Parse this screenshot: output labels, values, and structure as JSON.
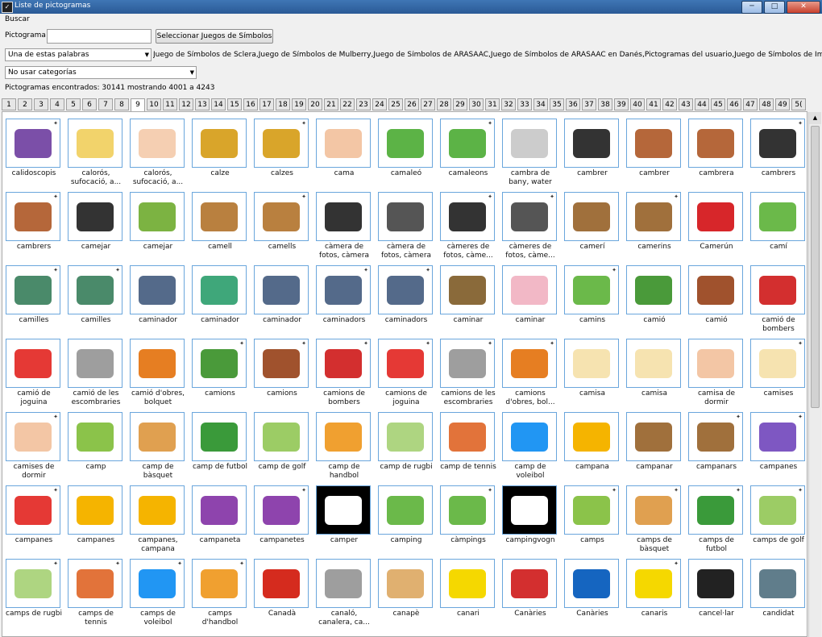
{
  "window": {
    "title": "Liste de pictogramas",
    "minimize": "─",
    "maximize": "□",
    "close": "✕"
  },
  "menu": {
    "search": "Buscar"
  },
  "search": {
    "label": "Pictograma",
    "value": "",
    "select_sets_button": "Seleccionar Juegos de Símbolos"
  },
  "word_mode": {
    "selected": "Una de estas palabras"
  },
  "sets_text": "Juego de Símbolos de Sclera,Juego de Símbolos de Mulberry,Juego de Símbolos de ARASAAC,Juego de Símbolos de ARASAAC en Danés,Pictogramas del usuario,Juego de Símbolos de Imagi",
  "category": {
    "selected": "No usar categorías"
  },
  "results_text": "Pictogramas encontrados: 30141 mostrando 4001 a 4243",
  "pages": {
    "active": "9",
    "items": [
      "1",
      "2",
      "3",
      "4",
      "5",
      "6",
      "7",
      "8",
      "9",
      "10",
      "11",
      "12",
      "13",
      "14",
      "15",
      "16",
      "17",
      "18",
      "19",
      "20",
      "21",
      "22",
      "23",
      "24",
      "25",
      "26",
      "27",
      "28",
      "29",
      "30",
      "31",
      "32",
      "33",
      "34",
      "35",
      "36",
      "37",
      "38",
      "39",
      "40",
      "41",
      "42",
      "43",
      "44",
      "45",
      "46",
      "47",
      "48",
      "49",
      "5("
    ]
  },
  "colors": {
    "cell_border": "#6aa6dc",
    "tab_active": "#ffffff",
    "titlebar": "#3f76b5"
  },
  "pictograms": [
    {
      "label": "calidoscopis",
      "star": true,
      "icon": "kaleidoscope-icon",
      "color": "#7b4fa8"
    },
    {
      "label": "calorós, sufocació, a...",
      "star": false,
      "icon": "hot-face-icon",
      "color": "#f2d36b"
    },
    {
      "label": "calorós, sufocació, a...",
      "star": false,
      "icon": "hot-baby-icon",
      "color": "#f5cfb2"
    },
    {
      "label": "calze",
      "star": false,
      "icon": "chalice-icon",
      "color": "#d9a52a"
    },
    {
      "label": "calzes",
      "star": true,
      "icon": "chalices-icon",
      "color": "#d9a52a"
    },
    {
      "label": "cama",
      "star": false,
      "icon": "leg-icon",
      "color": "#f3c6a5"
    },
    {
      "label": "camaleó",
      "star": false,
      "icon": "chameleon-icon",
      "color": "#5cb346"
    },
    {
      "label": "camaleons",
      "star": true,
      "icon": "chameleons-icon",
      "color": "#5cb346"
    },
    {
      "label": "cambra de bany, water",
      "star": false,
      "icon": "toilet-icon",
      "color": "#cccccc"
    },
    {
      "label": "cambrer",
      "star": false,
      "icon": "waiter-icon",
      "color": "#333333"
    },
    {
      "label": "cambrer",
      "star": false,
      "icon": "bar-waiter-icon",
      "color": "#b5673a"
    },
    {
      "label": "cambrera",
      "star": false,
      "icon": "bar-waitress-icon",
      "color": "#b5673a"
    },
    {
      "label": "cambrers",
      "star": true,
      "icon": "waiters-icon",
      "color": "#333333"
    },
    {
      "label": "cambrers",
      "star": true,
      "icon": "bar-waiters-icon",
      "color": "#b5673a"
    },
    {
      "label": "camejar",
      "star": false,
      "icon": "kicking-icon",
      "color": "#333333"
    },
    {
      "label": "camejar",
      "star": false,
      "icon": "kicking-child-icon",
      "color": "#7cb342"
    },
    {
      "label": "camell",
      "star": false,
      "icon": "camel-icon",
      "color": "#b9803f"
    },
    {
      "label": "camells",
      "star": true,
      "icon": "camels-icon",
      "color": "#b9803f"
    },
    {
      "label": "càmera de fotos, càmera",
      "star": false,
      "icon": "camera-icon",
      "color": "#333333"
    },
    {
      "label": "càmera de fotos, càmera",
      "star": false,
      "icon": "camera-photo-icon",
      "color": "#555555"
    },
    {
      "label": "càmeres de fotos, càme...",
      "star": true,
      "icon": "cameras-icon",
      "color": "#333333"
    },
    {
      "label": "càmeres de fotos, càme...",
      "star": true,
      "icon": "cameras-photo-icon",
      "color": "#555555"
    },
    {
      "label": "camerí",
      "star": false,
      "icon": "dressing-table-icon",
      "color": "#a0703c"
    },
    {
      "label": "camerins",
      "star": true,
      "icon": "dressing-tables-icon",
      "color": "#a0703c"
    },
    {
      "label": "Camerún",
      "star": false,
      "icon": "cameroon-flag-icon",
      "color": "#d7262a"
    },
    {
      "label": "camí",
      "star": false,
      "icon": "path-icon",
      "color": "#6bb94a"
    },
    {
      "label": "camilles",
      "star": true,
      "icon": "stretcher-icon",
      "color": "#4a8a6a"
    },
    {
      "label": "camilles",
      "star": true,
      "icon": "stretchers-icon",
      "color": "#4a8a6a"
    },
    {
      "label": "caminador",
      "star": false,
      "icon": "walker-icon",
      "color": "#546a8a"
    },
    {
      "label": "caminador",
      "star": false,
      "icon": "baby-walker-icon",
      "color": "#3fa77a"
    },
    {
      "label": "caminador",
      "star": false,
      "icon": "rollator-icon",
      "color": "#546a8a"
    },
    {
      "label": "caminadors",
      "star": true,
      "icon": "walkers-icon",
      "color": "#546a8a"
    },
    {
      "label": "caminadors",
      "star": true,
      "icon": "rollators-icon",
      "color": "#546a8a"
    },
    {
      "label": "caminar",
      "star": false,
      "icon": "walking-icon",
      "color": "#8a6a3a"
    },
    {
      "label": "caminar",
      "star": false,
      "icon": "baby-walking-icon",
      "color": "#f2b8c6"
    },
    {
      "label": "camins",
      "star": true,
      "icon": "paths-icon",
      "color": "#6bb94a"
    },
    {
      "label": "camió",
      "star": false,
      "icon": "truck-icon",
      "color": "#4a9a3a"
    },
    {
      "label": "camió",
      "star": false,
      "icon": "truck-2-icon",
      "color": "#a0522d"
    },
    {
      "label": "camió de bombers",
      "star": false,
      "icon": "fire-truck-icon",
      "color": "#d32f2f"
    },
    {
      "label": "camió de joguina",
      "star": false,
      "icon": "toy-truck-icon",
      "color": "#e53935"
    },
    {
      "label": "camió de les escombraries",
      "star": false,
      "icon": "garbage-truck-icon",
      "color": "#9e9e9e"
    },
    {
      "label": "camió d'obres, bolquet",
      "star": false,
      "icon": "dump-truck-icon",
      "color": "#e67e22"
    },
    {
      "label": "camions",
      "star": true,
      "icon": "trucks-icon",
      "color": "#4a9a3a"
    },
    {
      "label": "camions",
      "star": true,
      "icon": "trucks-2-icon",
      "color": "#a0522d"
    },
    {
      "label": "camions de bombers",
      "star": true,
      "icon": "fire-trucks-icon",
      "color": "#d32f2f"
    },
    {
      "label": "camions de joguina",
      "star": true,
      "icon": "toy-trucks-icon",
      "color": "#e53935"
    },
    {
      "label": "camions de les escombraries",
      "star": true,
      "icon": "garbage-trucks-icon",
      "color": "#9e9e9e"
    },
    {
      "label": "camions d'obres, bol...",
      "star": true,
      "icon": "dump-trucks-icon",
      "color": "#e67e22"
    },
    {
      "label": "camisa",
      "star": false,
      "icon": "shirt-icon",
      "color": "#f6e3b0"
    },
    {
      "label": "camisa",
      "star": false,
      "icon": "shirt-2-icon",
      "color": "#f6e3b0"
    },
    {
      "label": "camisa de dormir",
      "star": false,
      "icon": "nightgown-icon",
      "color": "#f3c6a5"
    },
    {
      "label": "camises",
      "star": true,
      "icon": "shirts-icon",
      "color": "#f6e3b0"
    },
    {
      "label": "camises de dormir",
      "star": true,
      "icon": "nightgowns-icon",
      "color": "#f3c6a5"
    },
    {
      "label": "camp",
      "star": false,
      "icon": "field-icon",
      "color": "#8bc34a"
    },
    {
      "label": "camp de bàsquet",
      "star": false,
      "icon": "basketball-court-icon",
      "color": "#e0a050"
    },
    {
      "label": "camp de futbol",
      "star": false,
      "icon": "football-field-icon",
      "color": "#3a9a3a"
    },
    {
      "label": "camp de golf",
      "star": false,
      "icon": "golf-course-icon",
      "color": "#9ccc65"
    },
    {
      "label": "camp de handbol",
      "star": false,
      "icon": "handball-court-icon",
      "color": "#f0a030"
    },
    {
      "label": "camp de rugbi",
      "star": false,
      "icon": "rugby-field-icon",
      "color": "#aed581"
    },
    {
      "label": "camp de tennis",
      "star": false,
      "icon": "tennis-court-icon",
      "color": "#e2733a"
    },
    {
      "label": "camp de voleibol",
      "star": false,
      "icon": "volleyball-court-icon",
      "color": "#2196f3"
    },
    {
      "label": "campana",
      "star": false,
      "icon": "bell-icon",
      "color": "#f5b400"
    },
    {
      "label": "campanar",
      "star": false,
      "icon": "bell-tower-icon",
      "color": "#a0703c"
    },
    {
      "label": "campanars",
      "star": true,
      "icon": "bell-towers-icon",
      "color": "#a0703c"
    },
    {
      "label": "campanes",
      "star": true,
      "icon": "bells-colored-icon",
      "color": "#7e57c2"
    },
    {
      "label": "campanes",
      "star": true,
      "icon": "bells-row-icon",
      "color": "#e53935"
    },
    {
      "label": "campanes",
      "star": false,
      "icon": "bell-2-icon",
      "color": "#f5b400"
    },
    {
      "label": "campanes, campana",
      "star": false,
      "icon": "christmas-bells-icon",
      "color": "#f5b400"
    },
    {
      "label": "campaneta",
      "star": false,
      "icon": "morning-glory-icon",
      "color": "#8e44ad"
    },
    {
      "label": "campanetes",
      "star": true,
      "icon": "morning-glories-icon",
      "color": "#8e44ad"
    },
    {
      "label": "camper",
      "star": false,
      "icon": "camper-icon",
      "color": "#ffffff",
      "dark": true
    },
    {
      "label": "camping",
      "star": false,
      "icon": "camping-icon",
      "color": "#6bb94a"
    },
    {
      "label": "càmpings",
      "star": true,
      "icon": "campings-icon",
      "color": "#6bb94a"
    },
    {
      "label": "campingvogn",
      "star": false,
      "icon": "caravan-icon",
      "color": "#ffffff",
      "dark": true
    },
    {
      "label": "camps",
      "star": true,
      "icon": "fields-icon",
      "color": "#8bc34a"
    },
    {
      "label": "camps de bàsquet",
      "star": true,
      "icon": "basketball-courts-icon",
      "color": "#e0a050"
    },
    {
      "label": "camps de futbol",
      "star": true,
      "icon": "football-fields-icon",
      "color": "#3a9a3a"
    },
    {
      "label": "camps de golf",
      "star": true,
      "icon": "golf-courses-icon",
      "color": "#9ccc65"
    },
    {
      "label": "camps de rugbi",
      "star": true,
      "icon": "rugby-fields-icon",
      "color": "#aed581"
    },
    {
      "label": "camps de tennis",
      "star": true,
      "icon": "tennis-courts-icon",
      "color": "#e2733a"
    },
    {
      "label": "camps de voleibol",
      "star": true,
      "icon": "volleyball-courts-icon",
      "color": "#2196f3"
    },
    {
      "label": "camps d'handbol",
      "star": true,
      "icon": "handball-courts-icon",
      "color": "#f0a030"
    },
    {
      "label": "Canadà",
      "star": false,
      "icon": "canada-flag-icon",
      "color": "#d52b1e"
    },
    {
      "label": "canaló, canalera, ca...",
      "star": false,
      "icon": "gutter-icon",
      "color": "#9e9e9e"
    },
    {
      "label": "canapè",
      "star": false,
      "icon": "canape-icon",
      "color": "#e0b070"
    },
    {
      "label": "canari",
      "star": false,
      "icon": "canary-icon",
      "color": "#f5d800"
    },
    {
      "label": "Canàries",
      "star": false,
      "icon": "canary-islands-map-icon",
      "color": "#d32f2f"
    },
    {
      "label": "Canàries",
      "star": false,
      "icon": "canary-islands-flag-icon",
      "color": "#1565c0"
    },
    {
      "label": "canaris",
      "star": true,
      "icon": "canaries-icon",
      "color": "#f5d800"
    },
    {
      "label": "cancel·lar",
      "star": false,
      "icon": "departures-board-icon",
      "color": "#222222"
    },
    {
      "label": "candidat",
      "star": false,
      "icon": "candidate-icon",
      "color": "#607d8b"
    }
  ]
}
